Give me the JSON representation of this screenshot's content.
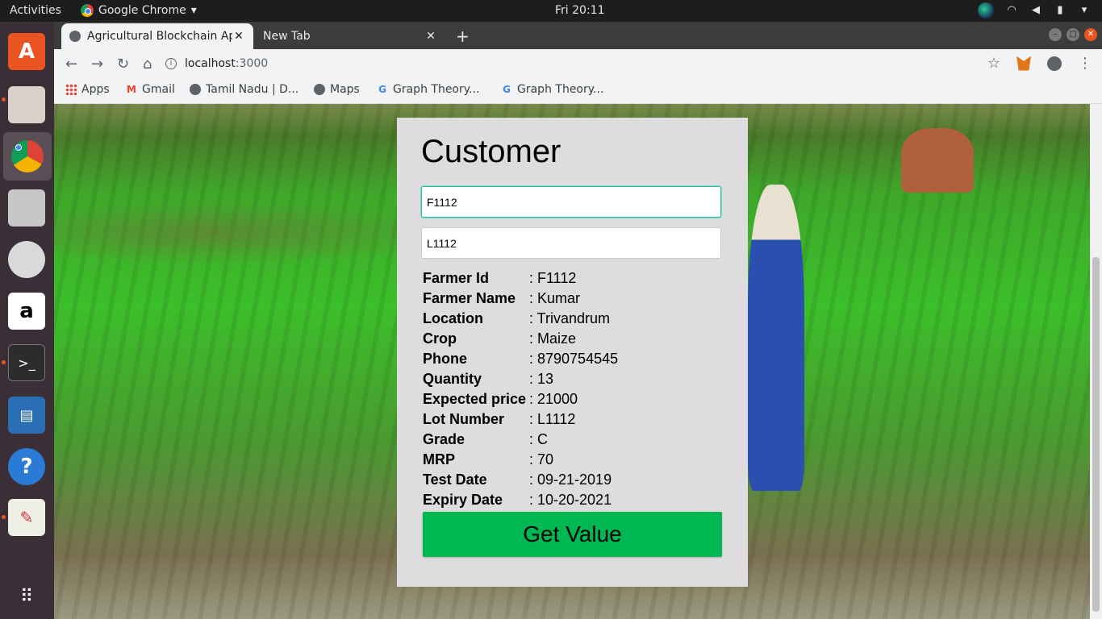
{
  "system": {
    "activities": "Activities",
    "app_menu": "Google Chrome",
    "clock": "Fri 20:11"
  },
  "browser": {
    "tabs": [
      {
        "title": "Agricultural Blockchain Ap",
        "active": true
      },
      {
        "title": "New Tab",
        "active": false
      }
    ],
    "url_host": "localhost",
    "url_port": ":3000",
    "bookmarks": [
      {
        "label": "Apps",
        "icon": "apps-grid-icon"
      },
      {
        "label": "Gmail",
        "icon": "gmail-icon"
      },
      {
        "label": "Tamil Nadu | D...",
        "icon": "globe-icon"
      },
      {
        "label": "Maps",
        "icon": "globe-icon"
      },
      {
        "label": "Graph Theory...",
        "icon": "google-icon"
      },
      {
        "label": "Graph Theory...",
        "icon": "google-icon"
      }
    ]
  },
  "page": {
    "heading": "Customer",
    "farmer_id_input": "F1112",
    "lot_number_input": "L1112",
    "details": [
      {
        "label": "Farmer Id",
        "value": ": F1112"
      },
      {
        "label": "Farmer Name",
        "value": ": Kumar"
      },
      {
        "label": "Location",
        "value": ": Trivandrum"
      },
      {
        "label": "Crop",
        "value": ": Maize"
      },
      {
        "label": "Phone",
        "value": ": 8790754545"
      },
      {
        "label": "Quantity",
        "value": ": 13"
      },
      {
        "label": "Expected price",
        "value": ": 21000"
      },
      {
        "label": "Lot Number",
        "value": ": L1112"
      },
      {
        "label": "Grade",
        "value": ": C"
      },
      {
        "label": "MRP",
        "value": ": 70"
      },
      {
        "label": "Test Date",
        "value": ": 09-21-2019"
      },
      {
        "label": "Expiry Date",
        "value": ": 10-20-2021"
      }
    ],
    "button_label": "Get Value"
  },
  "colors": {
    "button": "#00b851",
    "card": "#dedcde",
    "focus": "#2bbd9e"
  }
}
